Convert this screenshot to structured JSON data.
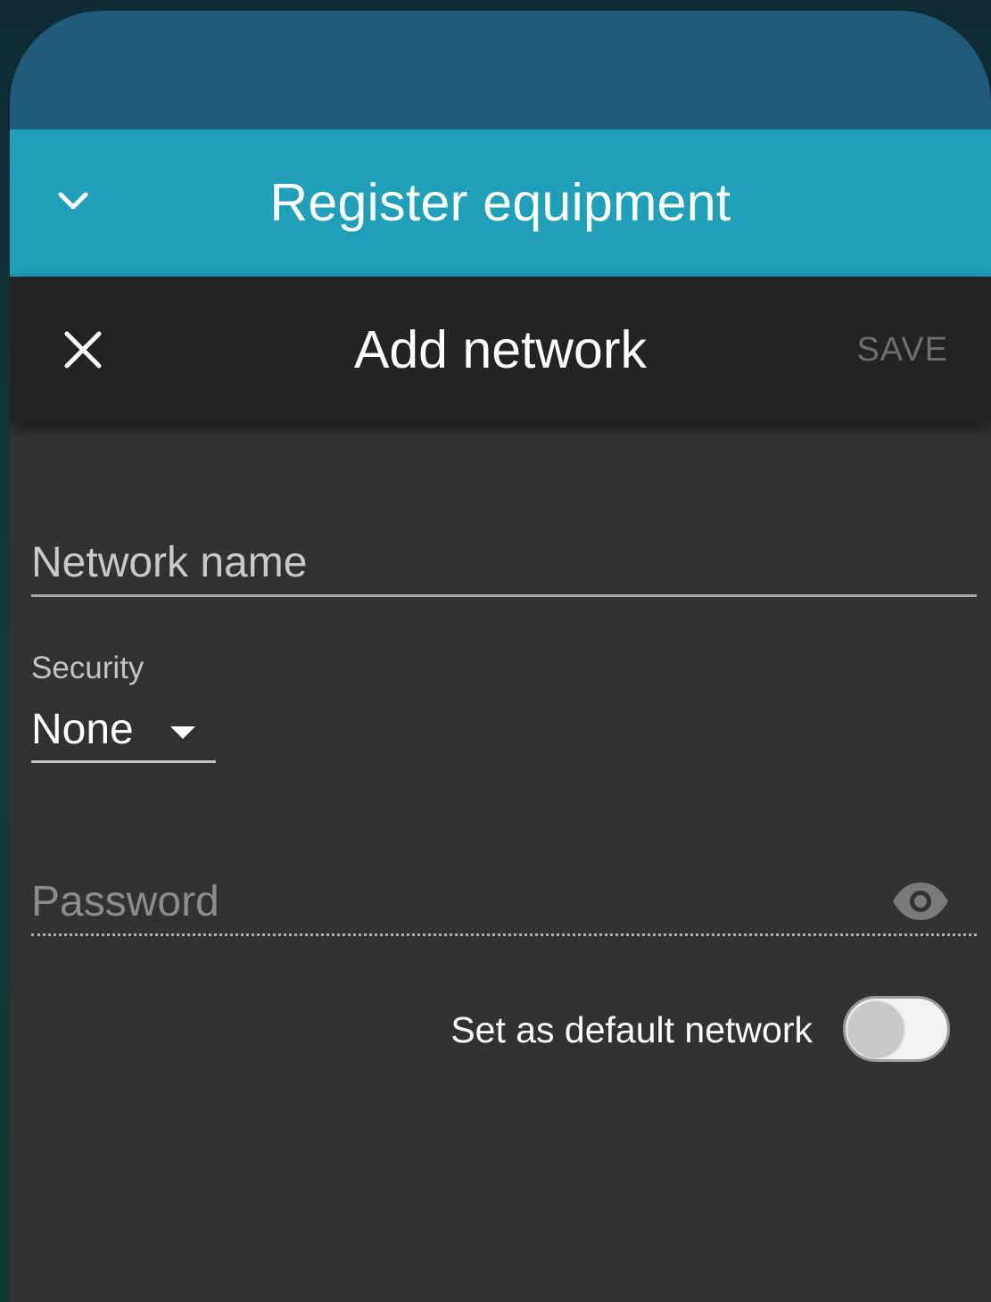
{
  "register_bar": {
    "title": "Register equipment",
    "collapse_icon": "chevron-down-icon"
  },
  "dialog": {
    "title": "Add network",
    "close_icon": "close-icon",
    "save_label": "SAVE"
  },
  "form": {
    "network_name": {
      "placeholder": "Network name",
      "value": ""
    },
    "security": {
      "label": "Security",
      "value": "None"
    },
    "password": {
      "placeholder": "Password",
      "value": "",
      "visibility_icon": "eye-icon"
    },
    "default_network": {
      "label": "Set as default network",
      "enabled": false
    }
  },
  "colors": {
    "sheet_top": "#205b7c",
    "accent_bar": "#1fa0b8",
    "dialog_header": "#232323",
    "form_background": "#323232",
    "save_disabled": "#6f6f6f"
  }
}
